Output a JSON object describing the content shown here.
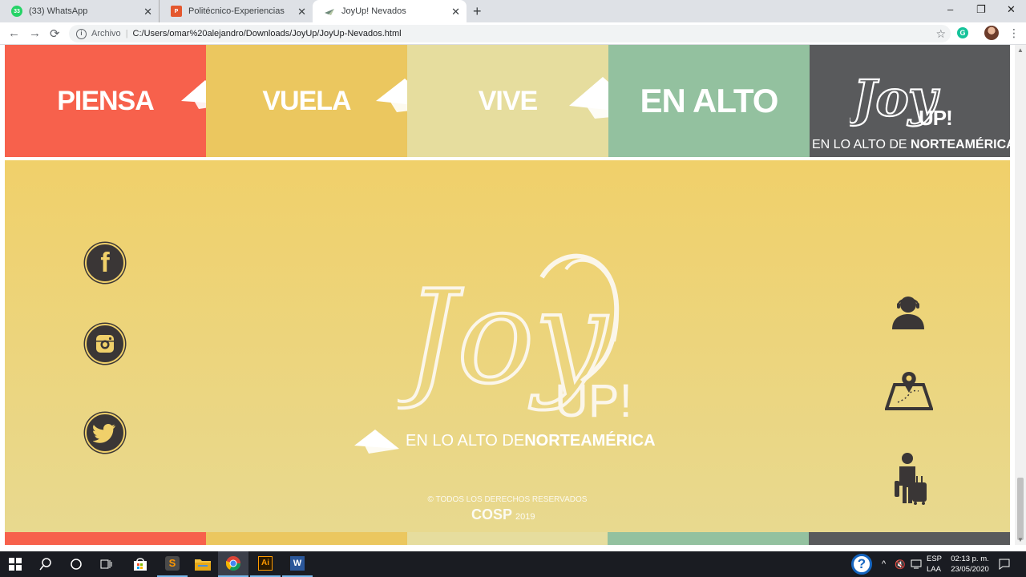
{
  "browser": {
    "tabs": [
      {
        "label": "(33) WhatsApp",
        "favicon_text": "33",
        "favicon_color": "#25d366"
      },
      {
        "label": "Politécnico-Experiencias",
        "favicon_text": "P",
        "favicon_color": "#e4572e"
      },
      {
        "label": "JoyUp! Nevados",
        "favicon_text": "",
        "favicon_color": "#5a6e8c",
        "active": true
      }
    ],
    "new_tab": "+",
    "window_controls": {
      "minimize": "–",
      "restore": "❐",
      "close": "✕"
    },
    "nav": {
      "back": "←",
      "forward": "→",
      "reload": "⟳"
    },
    "address": {
      "security_label": "Archivo",
      "url": "C:/Users/omar%20alejandro/Downloads/JoyUp/JoyUp-Nevados.html"
    },
    "bookmark_icon": "☆",
    "extension_letter": "G",
    "menu_icon": "⋮"
  },
  "banner": {
    "words": [
      "PIENSA",
      "VUELA",
      "VIVE",
      "EN ALTO"
    ],
    "logo_text": "Joy",
    "logo_up": "UP!",
    "tagline_light": "EN LO ALTO DE ",
    "tagline_bold": "NORTEAMÉRICA",
    "colors": [
      "#f7614c",
      "#ebc75f",
      "#e6dd9e",
      "#93c19f",
      "#595a5c"
    ]
  },
  "main": {
    "social": [
      "facebook",
      "instagram",
      "twitter"
    ],
    "right_icons": [
      "customer-support",
      "map-location",
      "traveler-luggage"
    ],
    "logo_text": "Joy",
    "logo_up": "UP!",
    "tagline_light": "EN LO ALTO DE ",
    "tagline_bold": "NORTEAMÉRICA",
    "copyright": "© TODOS LOS DERECHOS RESERVADOS",
    "brand": "COSP",
    "year": "2019"
  },
  "taskbar": {
    "language": "ESP",
    "layout": "LAA",
    "time": "02:13 p. m.",
    "date": "23/05/2020"
  }
}
